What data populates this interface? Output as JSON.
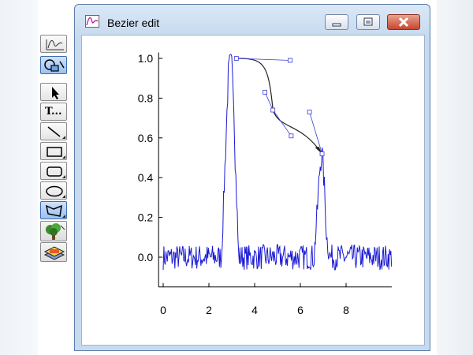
{
  "window": {
    "title": "Bezier edit"
  },
  "palette": {
    "tools": [
      {
        "id": "graph-mode",
        "icon": "graph-tool-icon",
        "active": false
      },
      {
        "id": "drawing-mode",
        "icon": "draw-layer-tool-icon",
        "active": true
      },
      {
        "id": "select",
        "icon": "arrow-pointer-icon",
        "active": false
      },
      {
        "id": "text",
        "icon": "text-tool-icon",
        "label": "T...",
        "active": false
      },
      {
        "id": "line",
        "icon": "line-tool-icon",
        "active": false
      },
      {
        "id": "rectangle",
        "icon": "rectangle-tool-icon",
        "active": false
      },
      {
        "id": "rounded-rectangle",
        "icon": "rounded-rectangle-tool-icon",
        "active": false
      },
      {
        "id": "oval",
        "icon": "oval-tool-icon",
        "active": false
      },
      {
        "id": "polygon",
        "icon": "polygon-tool-icon",
        "active": true
      },
      {
        "id": "layer-back",
        "icon": "tree-layer-icon",
        "active": false
      },
      {
        "id": "layer-front",
        "icon": "layer-stack-icon",
        "active": false
      }
    ]
  },
  "chart_data": {
    "type": "line",
    "xlim": [
      -0.2,
      10
    ],
    "ylim": [
      -0.15,
      1.03
    ],
    "x_ticks": [
      0,
      2,
      4,
      6,
      8
    ],
    "y_ticks": [
      0.0,
      0.2,
      0.4,
      0.6,
      0.8,
      1.0
    ],
    "x_tick_labels": [
      "0",
      "2",
      "4",
      "6",
      "8"
    ],
    "y_tick_labels": [
      "0.0",
      "0.2",
      "0.4",
      "0.6",
      "0.8",
      "1.0"
    ],
    "series": [
      {
        "color": "#1a1ad6",
        "noise_amplitude": 0.04,
        "envelope": [
          [
            0.0,
            0.0
          ],
          [
            2.55,
            0.0
          ],
          [
            2.75,
            0.6
          ],
          [
            2.85,
            0.92
          ],
          [
            2.95,
            1.0
          ],
          [
            3.05,
            0.95
          ],
          [
            3.15,
            0.5
          ],
          [
            3.3,
            0.0
          ],
          [
            6.6,
            0.0
          ],
          [
            6.75,
            0.25
          ],
          [
            6.85,
            0.45
          ],
          [
            6.95,
            0.53
          ],
          [
            7.05,
            0.35
          ],
          [
            7.15,
            0.1
          ],
          [
            7.3,
            0.0
          ],
          [
            10.0,
            0.0
          ]
        ]
      }
    ],
    "bezier": {
      "color": "#222222",
      "handle_color": "#3b3bd6",
      "curve": [
        [
          [
            3.2,
            1.0
          ],
          [
            4.4,
            1.0
          ],
          [
            4.6,
            0.98
          ],
          [
            4.8,
            0.74
          ]
        ],
        [
          [
            4.8,
            0.74
          ],
          [
            5.1,
            0.64
          ],
          [
            6.0,
            0.68
          ],
          [
            6.95,
            0.52
          ]
        ]
      ],
      "handles": [
        [
          [
            3.2,
            1.0
          ],
          [
            5.55,
            0.99
          ]
        ],
        [
          [
            4.45,
            0.83
          ],
          [
            4.8,
            0.74
          ],
          [
            5.6,
            0.61
          ]
        ],
        [
          [
            6.4,
            0.73
          ],
          [
            6.95,
            0.52
          ]
        ]
      ]
    }
  }
}
